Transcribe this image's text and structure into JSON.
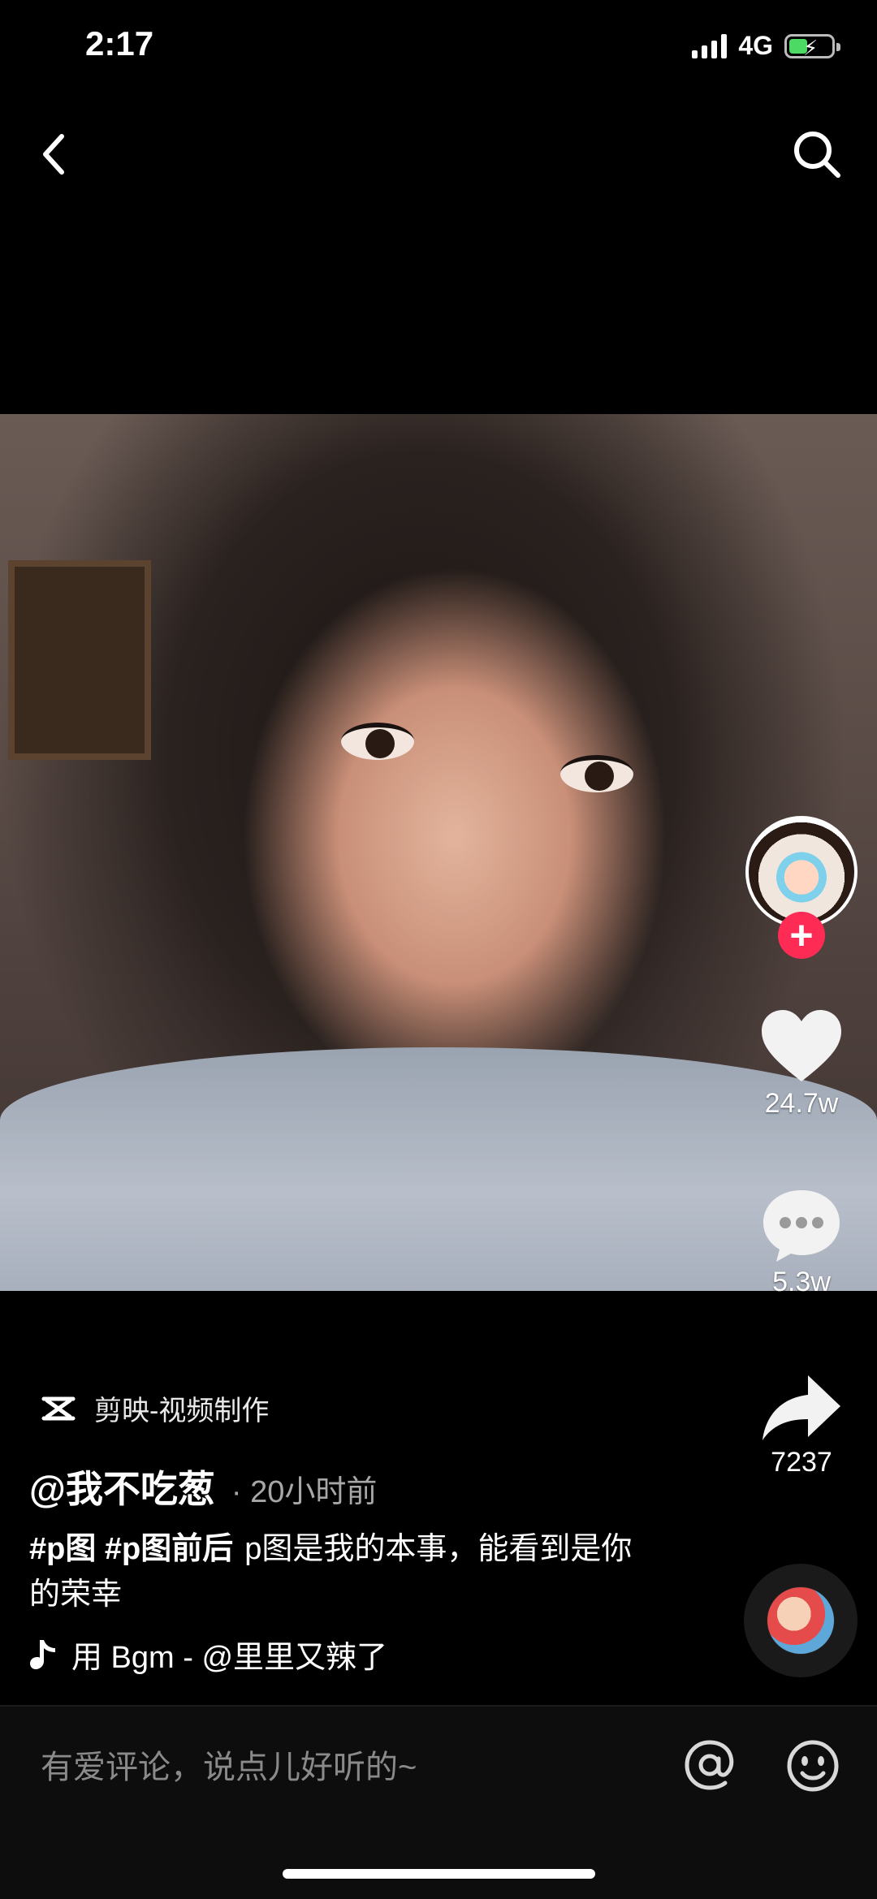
{
  "status_bar": {
    "time": "2:17",
    "network": "4G",
    "battery_level": 0.4,
    "battery_color": "#4cd964"
  },
  "nav": {
    "back_icon": "chevron-left-icon",
    "search_icon": "search-icon"
  },
  "right_rail": {
    "follow_plus": "+",
    "follow_color": "#fe2c55",
    "likes": "24.7w",
    "comments": "5.3w",
    "shares": "7237"
  },
  "post": {
    "source_app": "剪映-视频制作",
    "author": "@我不吃葱",
    "time_ago": "· 20小时前",
    "hashtags": "#p图 #p图前后",
    "caption_text": "p图是我的本事，能看到是你的荣幸",
    "music": "用 Bgm - @里里又辣了",
    "music_fade": " "
  },
  "comment_bar": {
    "placeholder": "有爱评论，说点儿好听的~"
  }
}
